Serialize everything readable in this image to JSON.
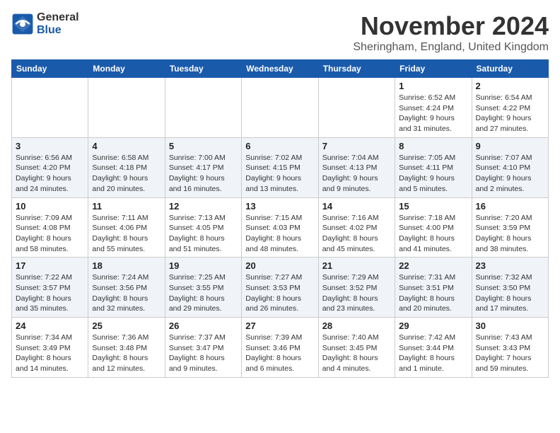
{
  "logo": {
    "general": "General",
    "blue": "Blue"
  },
  "header": {
    "month": "November 2024",
    "location": "Sheringham, England, United Kingdom"
  },
  "weekdays": [
    "Sunday",
    "Monday",
    "Tuesday",
    "Wednesday",
    "Thursday",
    "Friday",
    "Saturday"
  ],
  "weeks": [
    [
      {
        "day": "",
        "info": ""
      },
      {
        "day": "",
        "info": ""
      },
      {
        "day": "",
        "info": ""
      },
      {
        "day": "",
        "info": ""
      },
      {
        "day": "",
        "info": ""
      },
      {
        "day": "1",
        "info": "Sunrise: 6:52 AM\nSunset: 4:24 PM\nDaylight: 9 hours and 31 minutes."
      },
      {
        "day": "2",
        "info": "Sunrise: 6:54 AM\nSunset: 4:22 PM\nDaylight: 9 hours and 27 minutes."
      }
    ],
    [
      {
        "day": "3",
        "info": "Sunrise: 6:56 AM\nSunset: 4:20 PM\nDaylight: 9 hours and 24 minutes."
      },
      {
        "day": "4",
        "info": "Sunrise: 6:58 AM\nSunset: 4:18 PM\nDaylight: 9 hours and 20 minutes."
      },
      {
        "day": "5",
        "info": "Sunrise: 7:00 AM\nSunset: 4:17 PM\nDaylight: 9 hours and 16 minutes."
      },
      {
        "day": "6",
        "info": "Sunrise: 7:02 AM\nSunset: 4:15 PM\nDaylight: 9 hours and 13 minutes."
      },
      {
        "day": "7",
        "info": "Sunrise: 7:04 AM\nSunset: 4:13 PM\nDaylight: 9 hours and 9 minutes."
      },
      {
        "day": "8",
        "info": "Sunrise: 7:05 AM\nSunset: 4:11 PM\nDaylight: 9 hours and 5 minutes."
      },
      {
        "day": "9",
        "info": "Sunrise: 7:07 AM\nSunset: 4:10 PM\nDaylight: 9 hours and 2 minutes."
      }
    ],
    [
      {
        "day": "10",
        "info": "Sunrise: 7:09 AM\nSunset: 4:08 PM\nDaylight: 8 hours and 58 minutes."
      },
      {
        "day": "11",
        "info": "Sunrise: 7:11 AM\nSunset: 4:06 PM\nDaylight: 8 hours and 55 minutes."
      },
      {
        "day": "12",
        "info": "Sunrise: 7:13 AM\nSunset: 4:05 PM\nDaylight: 8 hours and 51 minutes."
      },
      {
        "day": "13",
        "info": "Sunrise: 7:15 AM\nSunset: 4:03 PM\nDaylight: 8 hours and 48 minutes."
      },
      {
        "day": "14",
        "info": "Sunrise: 7:16 AM\nSunset: 4:02 PM\nDaylight: 8 hours and 45 minutes."
      },
      {
        "day": "15",
        "info": "Sunrise: 7:18 AM\nSunset: 4:00 PM\nDaylight: 8 hours and 41 minutes."
      },
      {
        "day": "16",
        "info": "Sunrise: 7:20 AM\nSunset: 3:59 PM\nDaylight: 8 hours and 38 minutes."
      }
    ],
    [
      {
        "day": "17",
        "info": "Sunrise: 7:22 AM\nSunset: 3:57 PM\nDaylight: 8 hours and 35 minutes."
      },
      {
        "day": "18",
        "info": "Sunrise: 7:24 AM\nSunset: 3:56 PM\nDaylight: 8 hours and 32 minutes."
      },
      {
        "day": "19",
        "info": "Sunrise: 7:25 AM\nSunset: 3:55 PM\nDaylight: 8 hours and 29 minutes."
      },
      {
        "day": "20",
        "info": "Sunrise: 7:27 AM\nSunset: 3:53 PM\nDaylight: 8 hours and 26 minutes."
      },
      {
        "day": "21",
        "info": "Sunrise: 7:29 AM\nSunset: 3:52 PM\nDaylight: 8 hours and 23 minutes."
      },
      {
        "day": "22",
        "info": "Sunrise: 7:31 AM\nSunset: 3:51 PM\nDaylight: 8 hours and 20 minutes."
      },
      {
        "day": "23",
        "info": "Sunrise: 7:32 AM\nSunset: 3:50 PM\nDaylight: 8 hours and 17 minutes."
      }
    ],
    [
      {
        "day": "24",
        "info": "Sunrise: 7:34 AM\nSunset: 3:49 PM\nDaylight: 8 hours and 14 minutes."
      },
      {
        "day": "25",
        "info": "Sunrise: 7:36 AM\nSunset: 3:48 PM\nDaylight: 8 hours and 12 minutes."
      },
      {
        "day": "26",
        "info": "Sunrise: 7:37 AM\nSunset: 3:47 PM\nDaylight: 8 hours and 9 minutes."
      },
      {
        "day": "27",
        "info": "Sunrise: 7:39 AM\nSunset: 3:46 PM\nDaylight: 8 hours and 6 minutes."
      },
      {
        "day": "28",
        "info": "Sunrise: 7:40 AM\nSunset: 3:45 PM\nDaylight: 8 hours and 4 minutes."
      },
      {
        "day": "29",
        "info": "Sunrise: 7:42 AM\nSunset: 3:44 PM\nDaylight: 8 hours and 1 minute."
      },
      {
        "day": "30",
        "info": "Sunrise: 7:43 AM\nSunset: 3:43 PM\nDaylight: 7 hours and 59 minutes."
      }
    ]
  ]
}
